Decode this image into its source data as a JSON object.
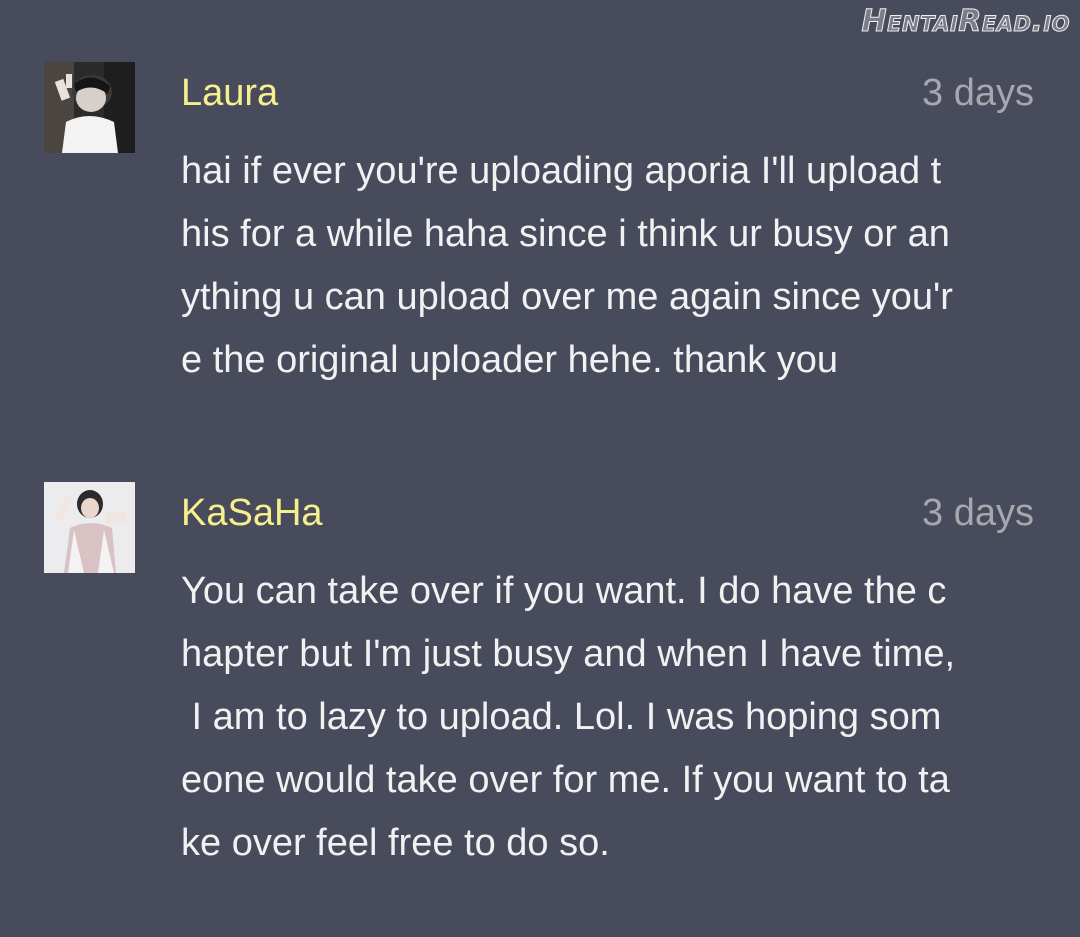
{
  "watermark": "HentaiRead.io",
  "comments": [
    {
      "username": "Laura",
      "timestamp": "3 days",
      "avatar_icon": "user-avatar-icon",
      "lines": [
        "hai if ever you're uploading aporia I'll upload t",
        "his for a while haha since i think ur busy or an",
        "ything u can upload over me again since you'r",
        "e the original uploader hehe. thank you"
      ]
    },
    {
      "username": "KaSaHa",
      "timestamp": "3 days",
      "avatar_icon": "user-avatar-icon",
      "lines": [
        "You can take over if you want. I do have the c",
        "hapter but I'm just busy and when I have time,",
        " I am to lazy to upload. Lol. I was hoping som",
        "eone would take over for me. If you want to ta",
        "ke over feel free to do so."
      ]
    }
  ],
  "colors": {
    "background": "#474b5b",
    "username": "#f7ef8e",
    "timestamp": "#a6a8ae",
    "body_text": "#f1f1f1"
  }
}
